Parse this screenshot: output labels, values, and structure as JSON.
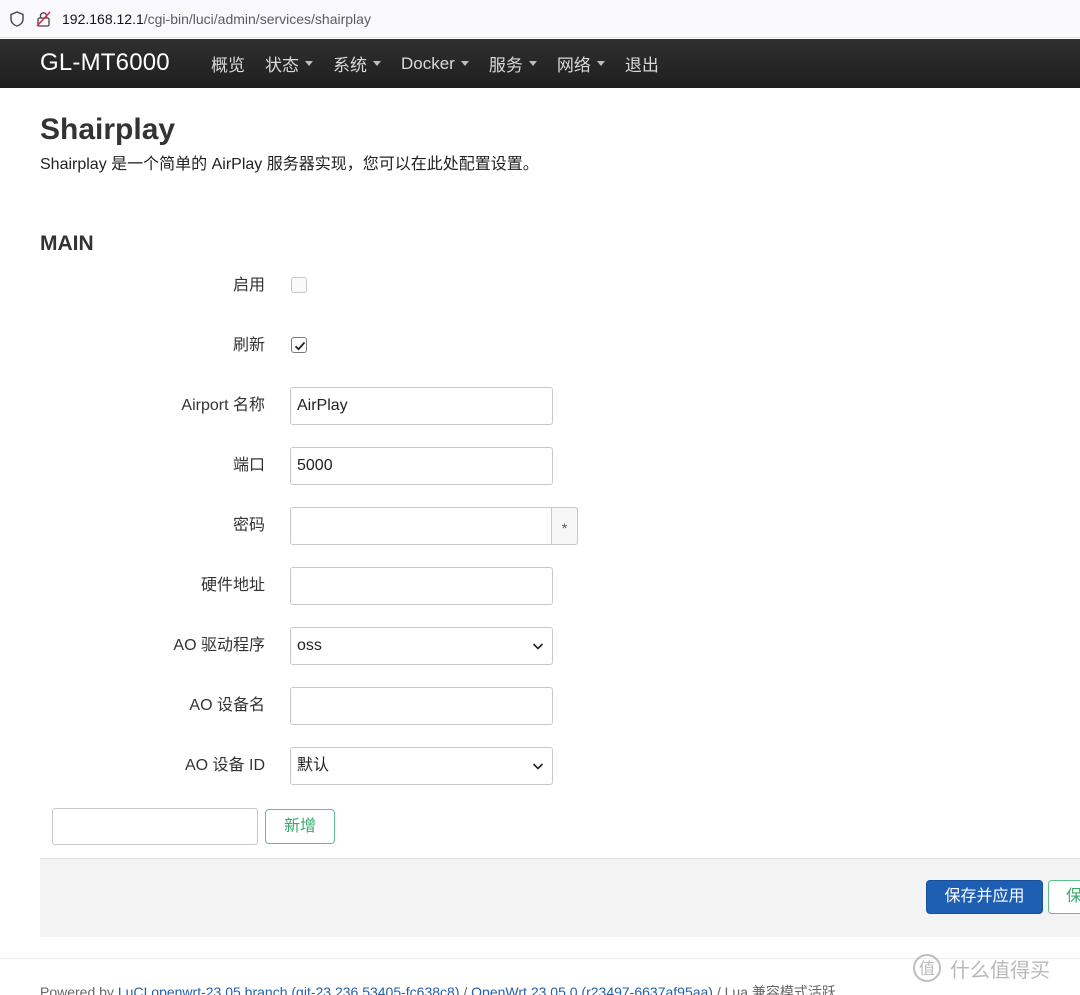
{
  "browser": {
    "url_host": "192.168.12.1",
    "url_path": "/cgi-bin/luci/admin/services/shairplay"
  },
  "nav": {
    "brand": "GL-MT6000",
    "items": [
      {
        "label": "概览",
        "dropdown": false
      },
      {
        "label": "状态",
        "dropdown": true
      },
      {
        "label": "系统",
        "dropdown": true
      },
      {
        "label": "Docker",
        "dropdown": true
      },
      {
        "label": "服务",
        "dropdown": true
      },
      {
        "label": "网络",
        "dropdown": true
      },
      {
        "label": "退出",
        "dropdown": false
      }
    ]
  },
  "page": {
    "title": "Shairplay",
    "description": "Shairplay 是一个简单的 AirPlay 服务器实现，您可以在此处配置设置。",
    "section_title": "MAIN"
  },
  "form": {
    "enable_label": "启用",
    "enable_checked": false,
    "refresh_label": "刷新",
    "refresh_checked": true,
    "airport_name_label": "Airport 名称",
    "airport_name_value": "AirPlay",
    "port_label": "端口",
    "port_value": "5000",
    "password_label": "密码",
    "password_value": "",
    "password_reveal_glyph": "*",
    "hw_addr_label": "硬件地址",
    "hw_addr_value": "",
    "ao_driver_label": "AO 驱动程序",
    "ao_driver_value": "oss",
    "ao_device_name_label": "AO 设备名",
    "ao_device_name_value": "",
    "ao_device_id_label": "AO 设备 ID",
    "ao_device_id_value": "默认",
    "add_input_value": "",
    "add_button_label": "新增"
  },
  "actions": {
    "save_apply_label": "保存并应用",
    "save_label": "保存"
  },
  "footer": {
    "prefix": "Powered by ",
    "luci_link": "LuCI openwrt-23.05 branch (git-23.236.53405-fc638c8)",
    "sep1": " / ",
    "openwrt_link": "OpenWrt 23.05.0 (r23497-6637af95aa)",
    "sep2": " / ",
    "tail": "Lua 兼容模式活跃"
  },
  "watermark": {
    "text": "什么值得买"
  },
  "colors": {
    "navbar": "#222222",
    "primary_button": "#1e5fb4",
    "positive_button": "#3aa86c",
    "link": "#1f5fad"
  }
}
